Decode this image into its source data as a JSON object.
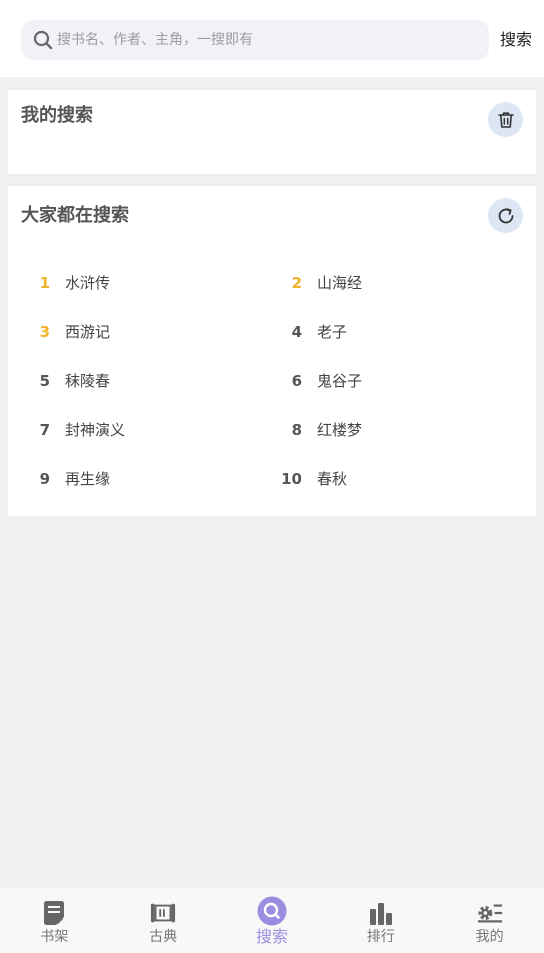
{
  "search": {
    "placeholder": "搜书名、作者、主角，一搜即有",
    "button_label": "搜索"
  },
  "my_search": {
    "title": "我的搜索"
  },
  "hot_search": {
    "title": "大家都在搜索",
    "items": [
      {
        "rank": "1",
        "name": "水浒传"
      },
      {
        "rank": "2",
        "name": "山海经"
      },
      {
        "rank": "3",
        "name": "西游记"
      },
      {
        "rank": "4",
        "name": "老子"
      },
      {
        "rank": "5",
        "name": "秣陵春"
      },
      {
        "rank": "6",
        "name": "鬼谷子"
      },
      {
        "rank": "7",
        "name": "封神演义"
      },
      {
        "rank": "8",
        "name": "红楼梦"
      },
      {
        "rank": "9",
        "name": "再生缘"
      },
      {
        "rank": "10",
        "name": "春秋"
      }
    ]
  },
  "nav": {
    "items": [
      {
        "label": "书架",
        "icon": "bookshelf-icon"
      },
      {
        "label": "古典",
        "icon": "scroll-icon"
      },
      {
        "label": "搜索",
        "icon": "search-icon",
        "active": true
      },
      {
        "label": "排行",
        "icon": "bar-chart-icon"
      },
      {
        "label": "我的",
        "icon": "settings-list-icon"
      }
    ]
  },
  "colors": {
    "accent": "#9a8ee0",
    "top_rank": "#f0b429",
    "circle_button_bg": "#dde6f4"
  }
}
